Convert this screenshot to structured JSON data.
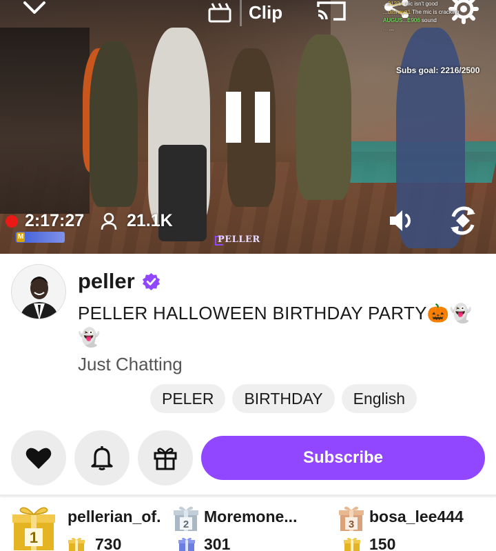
{
  "player": {
    "clip_label": "Clip",
    "subs_goal": "Subs goal: 2216/2500",
    "elapsed": "2:17:27",
    "viewers": "21.1K",
    "watermark": "PELLER",
    "chat_overlay": [
      {
        "user": "...0122x",
        "text": "mic isn't good"
      },
      {
        "user": "...uilshayz1",
        "text": "The mic is cracking"
      },
      {
        "user": "AUGUS...E906",
        "text": "sound"
      },
      {
        "user": "...",
        "text": "..."
      }
    ],
    "icons": [
      "chevron-down-icon",
      "clip-icon",
      "cast-icon",
      "share-icon",
      "gear-icon",
      "pause-icon",
      "viewer-icon",
      "volume-icon",
      "rotate-icon"
    ]
  },
  "channel": {
    "name": "peller",
    "title": "PELLER HALLOWEEN BIRTHDAY PARTY🎃👻👻",
    "category": "Just Chatting",
    "tags": [
      "PELER",
      "BIRTHDAY",
      "English"
    ]
  },
  "actions": {
    "subscribe_label": "Subscribe"
  },
  "leaderboard": [
    {
      "rank": "1",
      "name": "pellerian_of.",
      "count": "730"
    },
    {
      "rank": "2",
      "name": "Moremone...",
      "count": "301"
    },
    {
      "rank": "3",
      "name": "bosa_lee444",
      "count": "150"
    }
  ],
  "colors": {
    "accent": "#9147ff",
    "live": "#e91916",
    "gold": "#e5b422",
    "silver": "#a9b8c4",
    "bronze": "#d9a27a"
  }
}
